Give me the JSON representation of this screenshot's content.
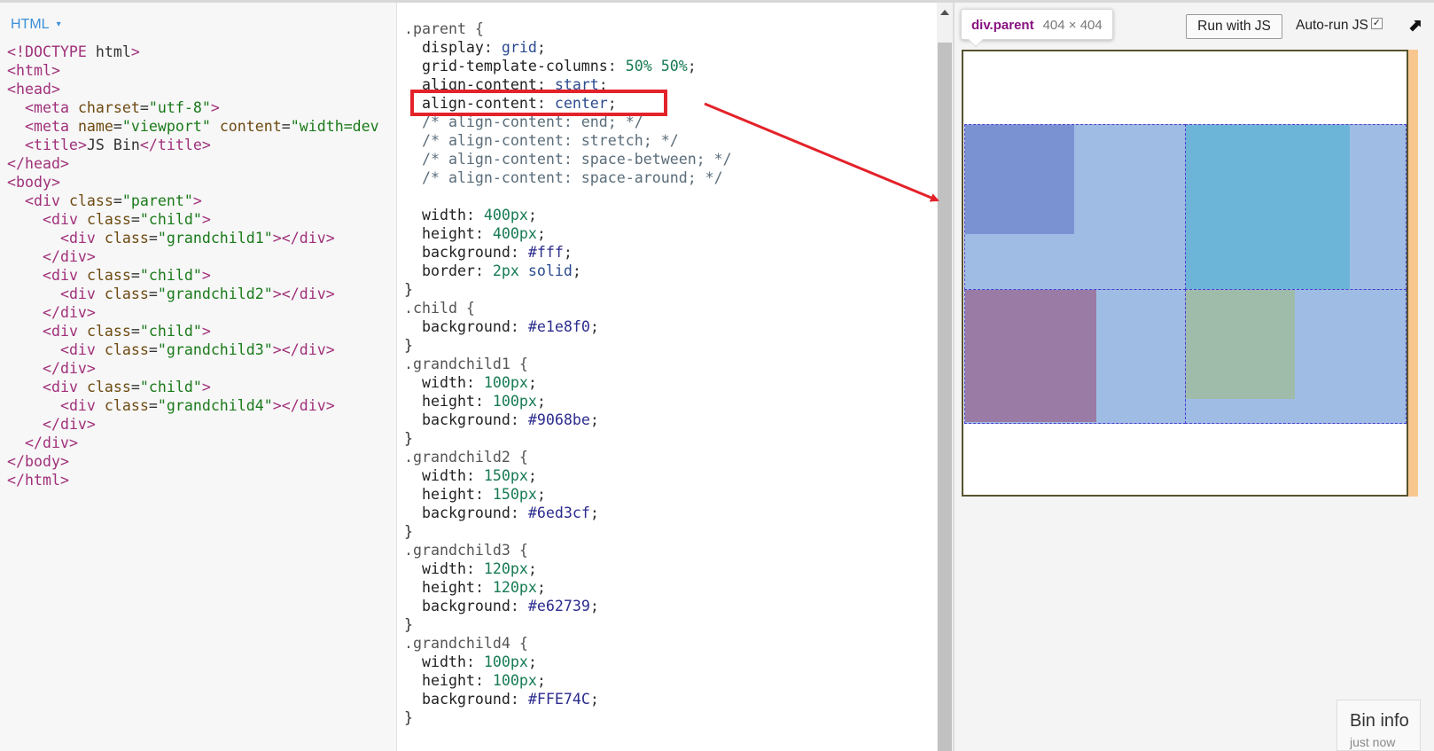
{
  "html_panel": {
    "title": "HTML",
    "caret": "▾",
    "lines": [
      "<!DOCTYPE html>",
      "<html>",
      "<head>",
      "  <meta charset=\"utf-8\">",
      "  <meta name=\"viewport\" content=\"width=dev",
      "  <title>JS Bin</title>",
      "</head>",
      "<body>",
      "  <div class=\"parent\">",
      "    <div class=\"child\">",
      "      <div class=\"grandchild1\"></div>",
      "    </div>",
      "    <div class=\"child\">",
      "      <div class=\"grandchild2\"></div>",
      "    </div>",
      "    <div class=\"child\">",
      "      <div class=\"grandchild3\"></div>",
      "    </div>",
      "    <div class=\"child\">",
      "      <div class=\"grandchild4\"></div>",
      "    </div>",
      "  </div>",
      "</body>",
      "</html>"
    ],
    "highlighted_line": 19
  },
  "css_panel": {
    "lines": [
      ".parent {",
      "  display: grid;",
      "  grid-template-columns: 50% 50%;",
      "  align-content: start;",
      "  align-content: center;",
      "  /* align-content: end; */",
      "  /* align-content: stretch; */",
      "  /* align-content: space-between; */",
      "  /* align-content: space-around; */",
      "",
      "  width: 400px;",
      "  height: 400px;",
      "  background: #fff;",
      "  border: 2px solid;",
      "}",
      ".child {",
      "  background: #e1e8f0;",
      "}",
      ".grandchild1 {",
      "  width: 100px;",
      "  height: 100px;",
      "  background: #9068be;",
      "}",
      ".grandchild2 {",
      "  width: 150px;",
      "  height: 150px;",
      "  background: #6ed3cf;",
      "}",
      ".grandchild3 {",
      "  width: 120px;",
      "  height: 120px;",
      "  background: #e62739;",
      "}",
      ".grandchild4 {",
      "  width: 100px;",
      "  height: 100px;",
      "  background: #FFE74C;",
      "}"
    ],
    "highlighted_line": 5
  },
  "output_panel": {
    "inspect_selector": "div.parent",
    "inspect_dims": "404 × 404",
    "run_button": "Run with JS",
    "autorun_label": "Auto-run JS",
    "autorun_check": "✓",
    "popout_icon": "⬈",
    "bin_info_title": "Bin info",
    "bin_info_sub": "just now"
  },
  "colors": {
    "annotation_red": "#e3222a",
    "grid_overlay": "#9fbde4",
    "grandchild1_tint": "#7b92d2",
    "grandchild2_tint": "#6cb5d8",
    "grandchild3_tint": "#9a7ba5",
    "grandchild4_tint": "#9fbba9",
    "margin_highlight": "#f8c78f"
  }
}
